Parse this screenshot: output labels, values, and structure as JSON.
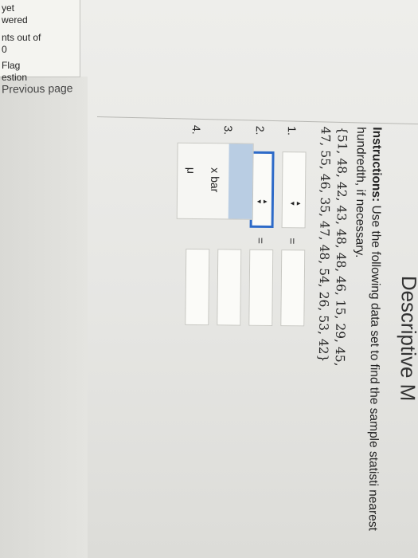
{
  "sidebar": {
    "lines": [
      "yet",
      "wered",
      "nts out of",
      "0",
      "Flag",
      "estion"
    ],
    "previous_page": "Previous page"
  },
  "page": {
    "title": "Descriptive M",
    "instructions_bold": "Instructions:",
    "instructions_text": "Use the following data set to find the sample statisti nearest hundredth, if necessary.",
    "data_line_1": "{51, 48, 42, 43, 48, 48, 46, 15, 29, 45,",
    "data_line_2": "47, 55, 46, 35, 47, 48, 54, 26, 53, 42}"
  },
  "form": {
    "rows": [
      {
        "num": "1.",
        "eq": "="
      },
      {
        "num": "2.",
        "eq": "="
      },
      {
        "num": "3.",
        "eq": ""
      },
      {
        "num": "4.",
        "eq": ""
      }
    ],
    "dropdown_options": [
      "",
      "x bar",
      "μ"
    ]
  },
  "colors": {
    "active_border": "#2d6ac8",
    "highlight": "#b9cde3"
  }
}
